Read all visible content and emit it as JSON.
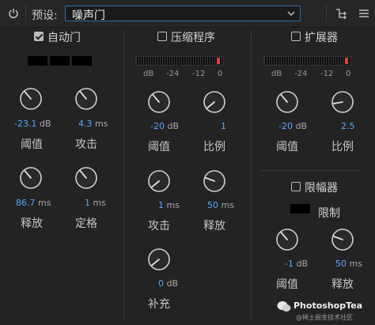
{
  "toolbar": {
    "preset_label": "预设:",
    "preset_value": "噪声门",
    "power_icon": "power-icon",
    "routing_icon": "routing-icon"
  },
  "gate": {
    "title": "自动门",
    "enabled": true,
    "knobs": [
      {
        "value": "-23.1",
        "unit": "dB",
        "label": "阈值"
      },
      {
        "value": "4.3",
        "unit": "ms",
        "label": "攻击"
      },
      {
        "value": "86.7",
        "unit": "ms",
        "label": "释放"
      },
      {
        "value": "1",
        "unit": "ms",
        "label": "定格"
      }
    ]
  },
  "compressor": {
    "title": "压缩程序",
    "enabled": false,
    "meter_scale": [
      "dB",
      "-24",
      "-12",
      "0"
    ],
    "knobs": [
      {
        "value": "-20",
        "unit": "dB",
        "label": "阈值"
      },
      {
        "value": "1",
        "unit": "",
        "label": "比例"
      },
      {
        "value": "1",
        "unit": "ms",
        "label": "攻击"
      },
      {
        "value": "50",
        "unit": "ms",
        "label": "释放"
      },
      {
        "value": "0",
        "unit": "dB",
        "label": "补充"
      }
    ]
  },
  "expander": {
    "title": "扩展器",
    "enabled": false,
    "meter_scale": [
      "dB",
      "-24",
      "-12",
      "0"
    ],
    "knobs": [
      {
        "value": "-20",
        "unit": "dB",
        "label": "阈值"
      },
      {
        "value": "2.5",
        "unit": "",
        "label": "比例"
      }
    ]
  },
  "limiter": {
    "title": "限幅器",
    "enabled": false,
    "limit_label": "限制",
    "knobs": [
      {
        "value": "-1",
        "unit": "dB",
        "label": "阈值"
      },
      {
        "value": "50",
        "unit": "ms",
        "label": "释放"
      }
    ]
  },
  "watermark": {
    "brand": "PhotoshopTea",
    "sub": "@稀土掘金技术社区"
  },
  "colors": {
    "accent": "#5aa6ff",
    "meter_peak": "#e0404a",
    "select_border": "#2f6fb0"
  }
}
